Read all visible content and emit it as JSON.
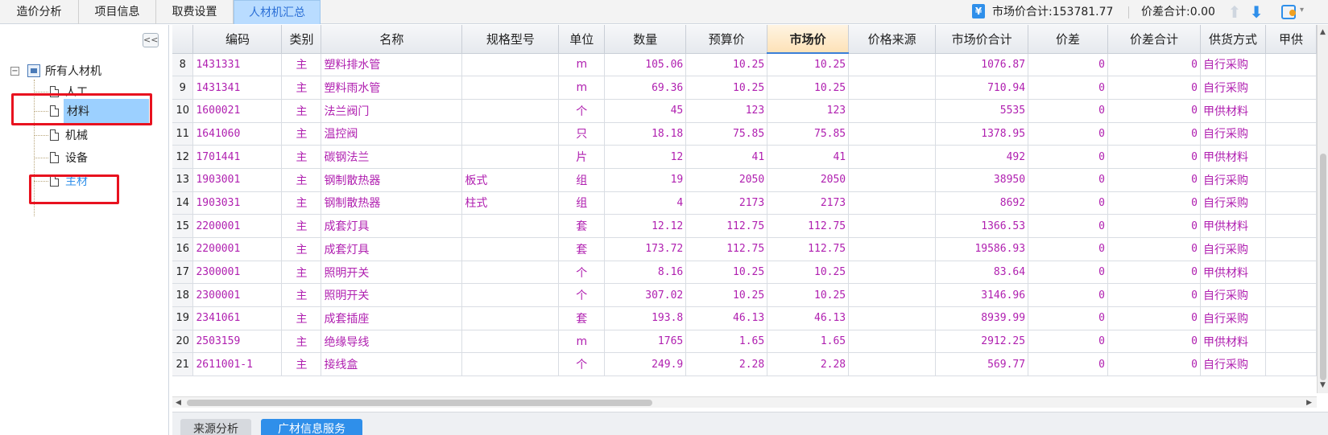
{
  "tabs": [
    {
      "label": "造价分析",
      "active": false
    },
    {
      "label": "项目信息",
      "active": false
    },
    {
      "label": "取费设置",
      "active": false
    },
    {
      "label": "人材机汇总",
      "active": true
    }
  ],
  "summary": {
    "market_total_label": "市场价合计:153781.77",
    "diff_total_label": "价差合计:0.00",
    "yuan_icon": "¥"
  },
  "sidebar": {
    "collapse_glyph": "<<",
    "root_label": "所有人材机",
    "items": [
      {
        "label": "人工"
      },
      {
        "label": "材料"
      },
      {
        "label": "机械"
      },
      {
        "label": "设备"
      },
      {
        "label": "主材"
      }
    ]
  },
  "grid": {
    "columns": [
      "编码",
      "类别",
      "名称",
      "规格型号",
      "单位",
      "数量",
      "预算价",
      "市场价",
      "价格来源",
      "市场价合计",
      "价差",
      "价差合计",
      "供货方式",
      "甲供"
    ],
    "rows": [
      {
        "no": "8",
        "code": "1431331",
        "type": "主",
        "name": "塑料排水管",
        "spec": "",
        "unit": "m",
        "qty": "105.06",
        "budget": "10.25",
        "market": "10.25",
        "source": "",
        "market_total": "1076.87",
        "diff": "0",
        "diff_total": "0",
        "supply": "自行采购"
      },
      {
        "no": "9",
        "code": "1431341",
        "type": "主",
        "name": "塑料雨水管",
        "spec": "",
        "unit": "m",
        "qty": "69.36",
        "budget": "10.25",
        "market": "10.25",
        "source": "",
        "market_total": "710.94",
        "diff": "0",
        "diff_total": "0",
        "supply": "自行采购"
      },
      {
        "no": "10",
        "code": "1600021",
        "type": "主",
        "name": "法兰阀门",
        "spec": "",
        "unit": "个",
        "qty": "45",
        "budget": "123",
        "market": "123",
        "source": "",
        "market_total": "5535",
        "diff": "0",
        "diff_total": "0",
        "supply": "甲供材料"
      },
      {
        "no": "11",
        "code": "1641060",
        "type": "主",
        "name": "温控阀",
        "spec": "",
        "unit": "只",
        "qty": "18.18",
        "budget": "75.85",
        "market": "75.85",
        "source": "",
        "market_total": "1378.95",
        "diff": "0",
        "diff_total": "0",
        "supply": "自行采购"
      },
      {
        "no": "12",
        "code": "1701441",
        "type": "主",
        "name": "碳钢法兰",
        "spec": "",
        "unit": "片",
        "qty": "12",
        "budget": "41",
        "market": "41",
        "source": "",
        "market_total": "492",
        "diff": "0",
        "diff_total": "0",
        "supply": "甲供材料"
      },
      {
        "no": "13",
        "code": "1903001",
        "type": "主",
        "name": "钢制散热器",
        "spec": "板式",
        "unit": "组",
        "qty": "19",
        "budget": "2050",
        "market": "2050",
        "source": "",
        "market_total": "38950",
        "diff": "0",
        "diff_total": "0",
        "supply": "自行采购"
      },
      {
        "no": "14",
        "code": "1903031",
        "type": "主",
        "name": "钢制散热器",
        "spec": "柱式",
        "unit": "组",
        "qty": "4",
        "budget": "2173",
        "market": "2173",
        "source": "",
        "market_total": "8692",
        "diff": "0",
        "diff_total": "0",
        "supply": "自行采购"
      },
      {
        "no": "15",
        "code": "2200001",
        "type": "主",
        "name": "成套灯具",
        "spec": "",
        "unit": "套",
        "qty": "12.12",
        "budget": "112.75",
        "market": "112.75",
        "source": "",
        "market_total": "1366.53",
        "diff": "0",
        "diff_total": "0",
        "supply": "甲供材料"
      },
      {
        "no": "16",
        "code": "2200001",
        "type": "主",
        "name": "成套灯具",
        "spec": "",
        "unit": "套",
        "qty": "173.72",
        "budget": "112.75",
        "market": "112.75",
        "source": "",
        "market_total": "19586.93",
        "diff": "0",
        "diff_total": "0",
        "supply": "自行采购"
      },
      {
        "no": "17",
        "code": "2300001",
        "type": "主",
        "name": "照明开关",
        "spec": "",
        "unit": "个",
        "qty": "8.16",
        "budget": "10.25",
        "market": "10.25",
        "source": "",
        "market_total": "83.64",
        "diff": "0",
        "diff_total": "0",
        "supply": "甲供材料"
      },
      {
        "no": "18",
        "code": "2300001",
        "type": "主",
        "name": "照明开关",
        "spec": "",
        "unit": "个",
        "qty": "307.02",
        "budget": "10.25",
        "market": "10.25",
        "source": "",
        "market_total": "3146.96",
        "diff": "0",
        "diff_total": "0",
        "supply": "自行采购"
      },
      {
        "no": "19",
        "code": "2341061",
        "type": "主",
        "name": "成套插座",
        "spec": "",
        "unit": "套",
        "qty": "193.8",
        "budget": "46.13",
        "market": "46.13",
        "source": "",
        "market_total": "8939.99",
        "diff": "0",
        "diff_total": "0",
        "supply": "自行采购"
      },
      {
        "no": "20",
        "code": "2503159",
        "type": "主",
        "name": "绝缘导线",
        "spec": "",
        "unit": "m",
        "qty": "1765",
        "budget": "1.65",
        "market": "1.65",
        "source": "",
        "market_total": "2912.25",
        "diff": "0",
        "diff_total": "0",
        "supply": "甲供材料"
      },
      {
        "no": "21",
        "code": "2611001-1",
        "type": "主",
        "name": "接线盒",
        "spec": "",
        "unit": "个",
        "qty": "249.9",
        "budget": "2.28",
        "market": "2.28",
        "source": "",
        "market_total": "569.77",
        "diff": "0",
        "diff_total": "0",
        "supply": "自行采购"
      }
    ]
  },
  "bottom_tabs": [
    {
      "label": "来源分析"
    },
    {
      "label": "广材信息服务"
    }
  ],
  "colors": {
    "accent": "#2f8fea",
    "cell_text": "#b020b0",
    "highlight_box": "#e8121f"
  }
}
